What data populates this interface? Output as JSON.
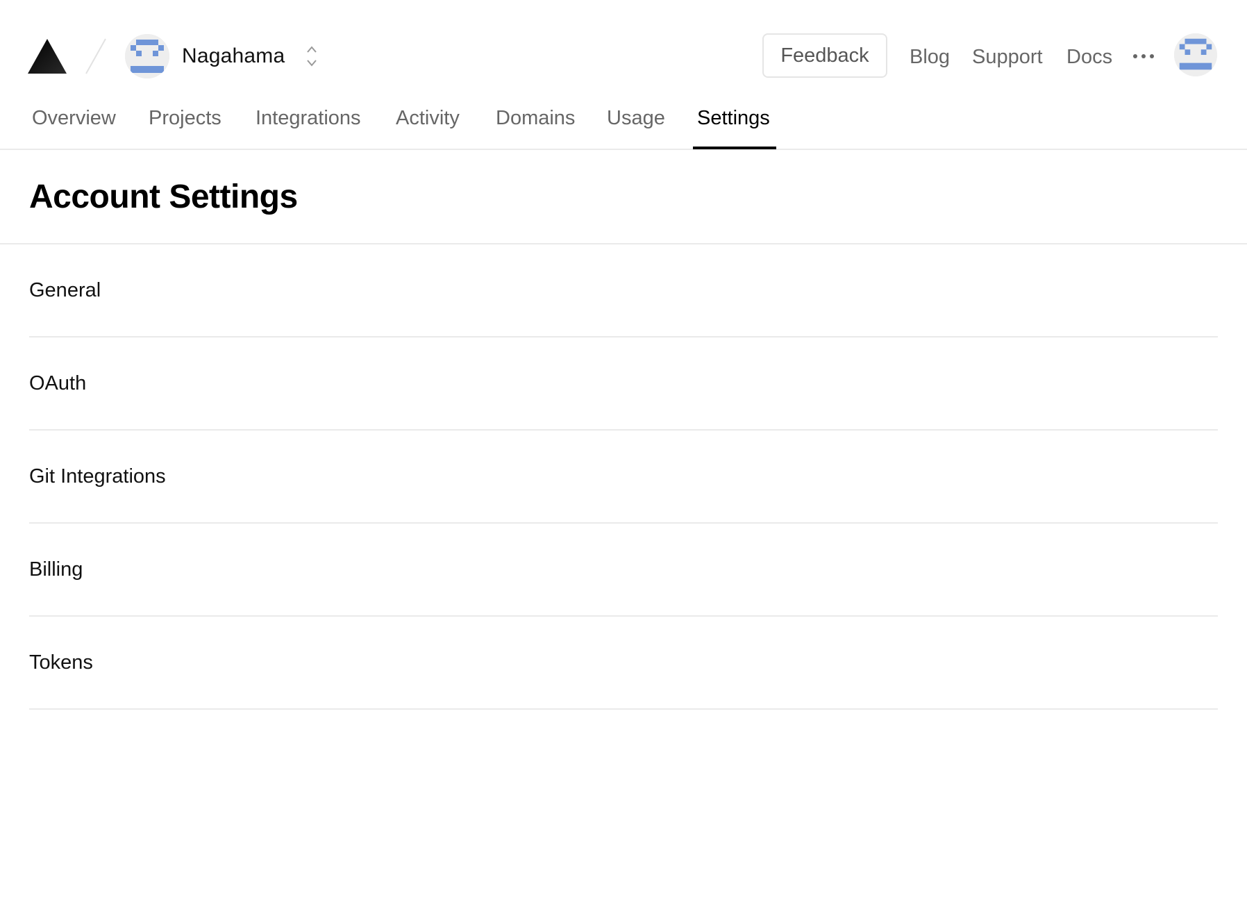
{
  "header": {
    "logo_icon": "triangle-logo-icon",
    "team": {
      "name": "Nagahama",
      "avatar_icon": "pixel-avatar-icon",
      "switcher_icon": "chevron-up-down-icon"
    },
    "feedback_label": "Feedback",
    "links": [
      {
        "label": "Blog"
      },
      {
        "label": "Support"
      },
      {
        "label": "Docs"
      }
    ],
    "more_icon": "ellipsis-icon",
    "user_avatar_icon": "pixel-avatar-icon"
  },
  "tabs": [
    {
      "label": "Overview",
      "active": false
    },
    {
      "label": "Projects",
      "active": false
    },
    {
      "label": "Integrations",
      "active": false
    },
    {
      "label": "Activity",
      "active": false
    },
    {
      "label": "Domains",
      "active": false
    },
    {
      "label": "Usage",
      "active": false
    },
    {
      "label": "Settings",
      "active": true
    }
  ],
  "page": {
    "title": "Account Settings"
  },
  "settings": {
    "items": [
      {
        "label": "General"
      },
      {
        "label": "OAuth"
      },
      {
        "label": "Git Integrations"
      },
      {
        "label": "Billing"
      },
      {
        "label": "Tokens"
      }
    ]
  },
  "colors": {
    "avatar_blue": "#6f95d8",
    "avatar_bg": "#eeeeee",
    "border": "#eaeaea",
    "muted_text": "#666666"
  }
}
